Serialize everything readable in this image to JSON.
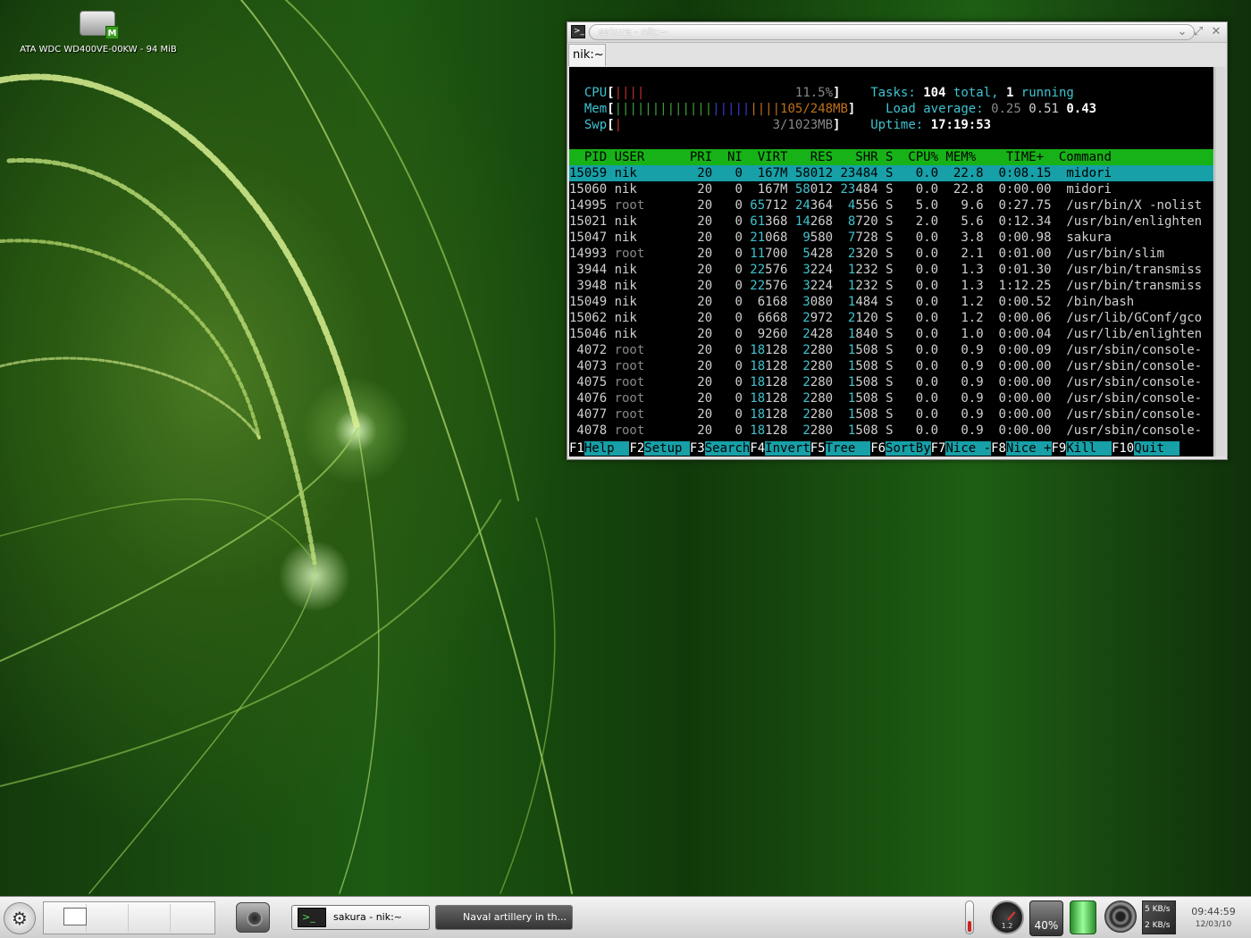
{
  "desktop": {
    "drive_label": "ATA WDC WD400VE-00KW - 94 MiB",
    "drive_badge": "M"
  },
  "terminal": {
    "window_title": "sakura - nik:~",
    "tab_label": "nik:~",
    "prompt_icon": ">_",
    "meters": {
      "cpu": {
        "label": "CPU",
        "bars": "||||",
        "value": "11.5%"
      },
      "mem": {
        "label": "Mem",
        "bars_green": "|||||||||||||",
        "bars_blue": "|||||",
        "bars_orange": "||||",
        "value": "105/248MB"
      },
      "swp": {
        "label": "Swp",
        "bars": "|",
        "value": "3/1023MB"
      }
    },
    "tasks": {
      "label": "Tasks:",
      "total": "104",
      "total_suffix": "total,",
      "running": "1",
      "running_suffix": "running"
    },
    "load": {
      "label": "Load average:",
      "v1": "0.25",
      "v2": "0.51",
      "v3": "0.43"
    },
    "uptime": {
      "label": "Uptime:",
      "value": "17:19:53"
    },
    "columns": [
      "PID",
      "USER",
      "PRI",
      "NI",
      "VIRT",
      "RES",
      "SHR",
      "S",
      "CPU%",
      "MEM%",
      "TIME+",
      "Command"
    ],
    "processes": [
      {
        "pid": "15059",
        "user": "nik",
        "pri": "20",
        "ni": "0",
        "virt": "167M",
        "res": "58012",
        "shr": "23484",
        "s": "S",
        "cpu": "0.0",
        "mem": "22.8",
        "time": "0:08.15",
        "cmd": "midori",
        "selected": true
      },
      {
        "pid": "15060",
        "user": "nik",
        "pri": "20",
        "ni": "0",
        "virt": "167M",
        "res": "58012",
        "shr": "23484",
        "s": "S",
        "cpu": "0.0",
        "mem": "22.8",
        "time": "0:00.00",
        "cmd": "midori"
      },
      {
        "pid": "14995",
        "user": "root",
        "pri": "20",
        "ni": "0",
        "virt": "65712",
        "res": "24364",
        "shr": "4556",
        "s": "S",
        "cpu": "5.0",
        "mem": "9.6",
        "time": "0:27.75",
        "cmd": "/usr/bin/X -nolist"
      },
      {
        "pid": "15021",
        "user": "nik",
        "pri": "20",
        "ni": "0",
        "virt": "61368",
        "res": "14268",
        "shr": "8720",
        "s": "S",
        "cpu": "2.0",
        "mem": "5.6",
        "time": "0:12.34",
        "cmd": "/usr/bin/enlighten"
      },
      {
        "pid": "15047",
        "user": "nik",
        "pri": "20",
        "ni": "0",
        "virt": "21068",
        "res": "9580",
        "shr": "7728",
        "s": "S",
        "cpu": "0.0",
        "mem": "3.8",
        "time": "0:00.98",
        "cmd": "sakura"
      },
      {
        "pid": "14993",
        "user": "root",
        "pri": "20",
        "ni": "0",
        "virt": "11700",
        "res": "5428",
        "shr": "2320",
        "s": "S",
        "cpu": "0.0",
        "mem": "2.1",
        "time": "0:01.00",
        "cmd": "/usr/bin/slim"
      },
      {
        "pid": "3944",
        "user": "nik",
        "pri": "20",
        "ni": "0",
        "virt": "22576",
        "res": "3224",
        "shr": "1232",
        "s": "S",
        "cpu": "0.0",
        "mem": "1.3",
        "time": "0:01.30",
        "cmd": "/usr/bin/transmiss"
      },
      {
        "pid": "3948",
        "user": "nik",
        "pri": "20",
        "ni": "0",
        "virt": "22576",
        "res": "3224",
        "shr": "1232",
        "s": "S",
        "cpu": "0.0",
        "mem": "1.3",
        "time": "1:12.25",
        "cmd": "/usr/bin/transmiss"
      },
      {
        "pid": "15049",
        "user": "nik",
        "pri": "20",
        "ni": "0",
        "virt": "6168",
        "res": "3080",
        "shr": "1484",
        "s": "S",
        "cpu": "0.0",
        "mem": "1.2",
        "time": "0:00.52",
        "cmd": "/bin/bash"
      },
      {
        "pid": "15062",
        "user": "nik",
        "pri": "20",
        "ni": "0",
        "virt": "6668",
        "res": "2972",
        "shr": "2120",
        "s": "S",
        "cpu": "0.0",
        "mem": "1.2",
        "time": "0:00.06",
        "cmd": "/usr/lib/GConf/gco"
      },
      {
        "pid": "15046",
        "user": "nik",
        "pri": "20",
        "ni": "0",
        "virt": "9260",
        "res": "2428",
        "shr": "1840",
        "s": "S",
        "cpu": "0.0",
        "mem": "1.0",
        "time": "0:00.04",
        "cmd": "/usr/lib/enlighten"
      },
      {
        "pid": "4072",
        "user": "root",
        "pri": "20",
        "ni": "0",
        "virt": "18128",
        "res": "2280",
        "shr": "1508",
        "s": "S",
        "cpu": "0.0",
        "mem": "0.9",
        "time": "0:00.09",
        "cmd": "/usr/sbin/console-"
      },
      {
        "pid": "4073",
        "user": "root",
        "pri": "20",
        "ni": "0",
        "virt": "18128",
        "res": "2280",
        "shr": "1508",
        "s": "S",
        "cpu": "0.0",
        "mem": "0.9",
        "time": "0:00.00",
        "cmd": "/usr/sbin/console-"
      },
      {
        "pid": "4075",
        "user": "root",
        "pri": "20",
        "ni": "0",
        "virt": "18128",
        "res": "2280",
        "shr": "1508",
        "s": "S",
        "cpu": "0.0",
        "mem": "0.9",
        "time": "0:00.00",
        "cmd": "/usr/sbin/console-"
      },
      {
        "pid": "4076",
        "user": "root",
        "pri": "20",
        "ni": "0",
        "virt": "18128",
        "res": "2280",
        "shr": "1508",
        "s": "S",
        "cpu": "0.0",
        "mem": "0.9",
        "time": "0:00.00",
        "cmd": "/usr/sbin/console-"
      },
      {
        "pid": "4077",
        "user": "root",
        "pri": "20",
        "ni": "0",
        "virt": "18128",
        "res": "2280",
        "shr": "1508",
        "s": "S",
        "cpu": "0.0",
        "mem": "0.9",
        "time": "0:00.00",
        "cmd": "/usr/sbin/console-"
      },
      {
        "pid": "4078",
        "user": "root",
        "pri": "20",
        "ni": "0",
        "virt": "18128",
        "res": "2280",
        "shr": "1508",
        "s": "S",
        "cpu": "0.0",
        "mem": "0.9",
        "time": "0:00.00",
        "cmd": "/usr/sbin/console-"
      }
    ],
    "function_keys": [
      {
        "key": "F1",
        "label": "Help  "
      },
      {
        "key": "F2",
        "label": "Setup "
      },
      {
        "key": "F3",
        "label": "Search"
      },
      {
        "key": "F4",
        "label": "Invert"
      },
      {
        "key": "F5",
        "label": "Tree  "
      },
      {
        "key": "F6",
        "label": "SortBy"
      },
      {
        "key": "F7",
        "label": "Nice -"
      },
      {
        "key": "F8",
        "label": "Nice +"
      },
      {
        "key": "F9",
        "label": "Kill  "
      },
      {
        "key": "F10",
        "label": "Quit  "
      }
    ]
  },
  "panel": {
    "tasks": [
      {
        "label": "sakura - nik:~",
        "icon": "terminal-icon"
      },
      {
        "label": "Naval artillery in th...",
        "icon": "browser-icon"
      }
    ],
    "gauge_label": "1.2",
    "battery_value": "40%",
    "net_up": "5 KB/s",
    "net_down": "2 KB/s",
    "clock_time": "09:44:59",
    "clock_date": "12/03/10"
  },
  "colors": {
    "htop_header": "#17b217",
    "htop_selected": "#17a0a8",
    "htop_cyan": "#3ec4d0",
    "desktop_green": "#1d5a12"
  }
}
